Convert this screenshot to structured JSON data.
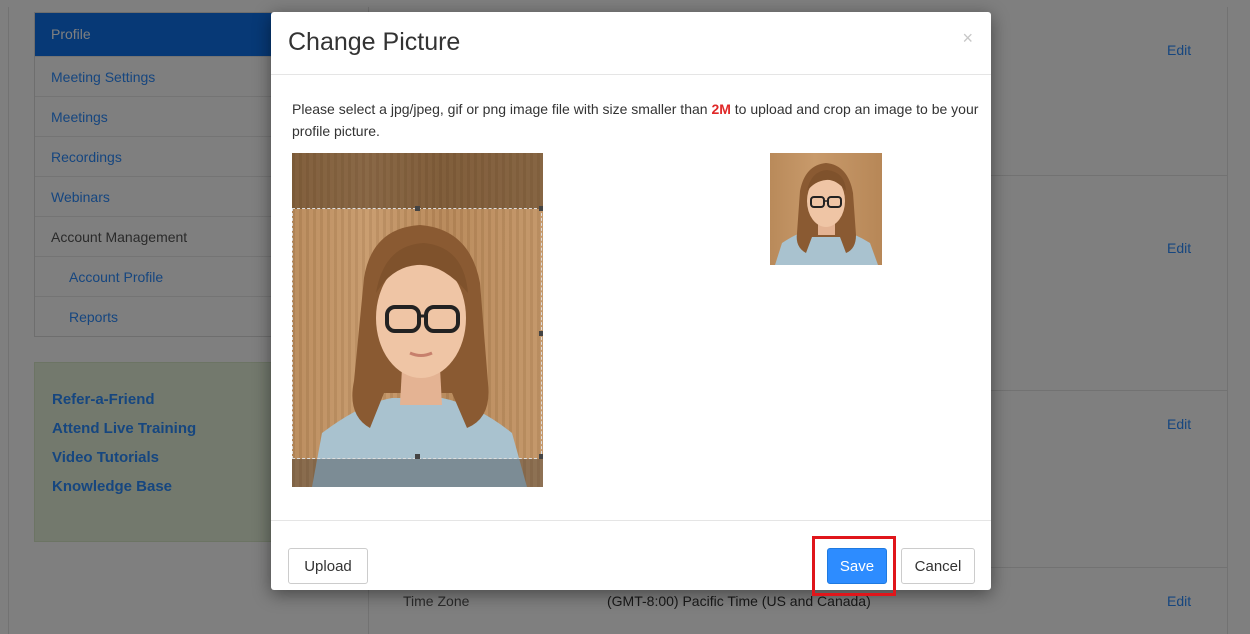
{
  "sidebar": {
    "items": [
      {
        "label": "Profile"
      },
      {
        "label": "Meeting Settings"
      },
      {
        "label": "Meetings"
      },
      {
        "label": "Recordings"
      },
      {
        "label": "Webinars"
      },
      {
        "label": "Account Management"
      },
      {
        "label": "Account Profile"
      },
      {
        "label": "Reports"
      }
    ],
    "help_links": [
      {
        "label": "Refer-a-Friend"
      },
      {
        "label": "Attend Live Training"
      },
      {
        "label": "Video Tutorials"
      },
      {
        "label": "Knowledge Base"
      }
    ]
  },
  "content": {
    "edit_label": "Edit",
    "time_zone_label": "Time Zone",
    "time_zone_value": "(GMT-8:00) Pacific Time (US and Canada)"
  },
  "modal": {
    "title": "Change Picture",
    "close_symbol": "×",
    "instructions_prefix": "Please select a jpg/jpeg, gif or png image file with size smaller than ",
    "size_limit": "2M",
    "instructions_suffix": " to upload and crop an image to be your profile picture.",
    "upload_label": "Upload",
    "save_label": "Save",
    "cancel_label": "Cancel"
  },
  "colors": {
    "accent": "#2d8cff",
    "highlight": "#e0161b",
    "size_limit": "#e02828"
  }
}
